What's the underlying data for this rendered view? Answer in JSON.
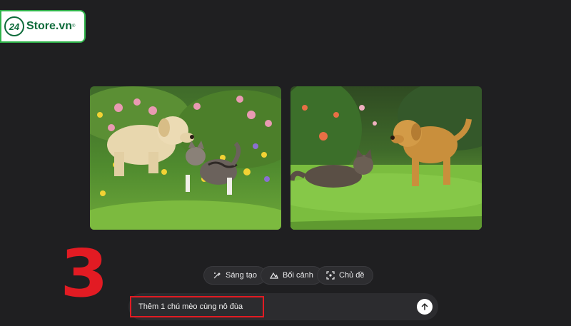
{
  "brand": {
    "logo_number": "24",
    "logo_text": "Store.vn",
    "logo_mark": "®"
  },
  "images": [
    {
      "id": "generated-image-1",
      "icon": "dog-and-kitten-image"
    },
    {
      "id": "generated-image-2",
      "icon": "dog-and-cat-image"
    }
  ],
  "step": {
    "number": "3"
  },
  "chips": [
    {
      "label": "Sáng tạo",
      "icon": "sparkle-brush-icon"
    },
    {
      "label": "Bối cảnh",
      "icon": "landscape-icon"
    },
    {
      "label": "Chủ đề",
      "icon": "focus-frame-icon"
    }
  ],
  "prompt": {
    "value": "Thêm 1 chú mèo cùng nô đùa",
    "send_icon": "arrow-up-icon"
  },
  "colors": {
    "background": "#1f1f21",
    "highlight": "#e21b23",
    "brand_green": "#0d6b3a"
  }
}
